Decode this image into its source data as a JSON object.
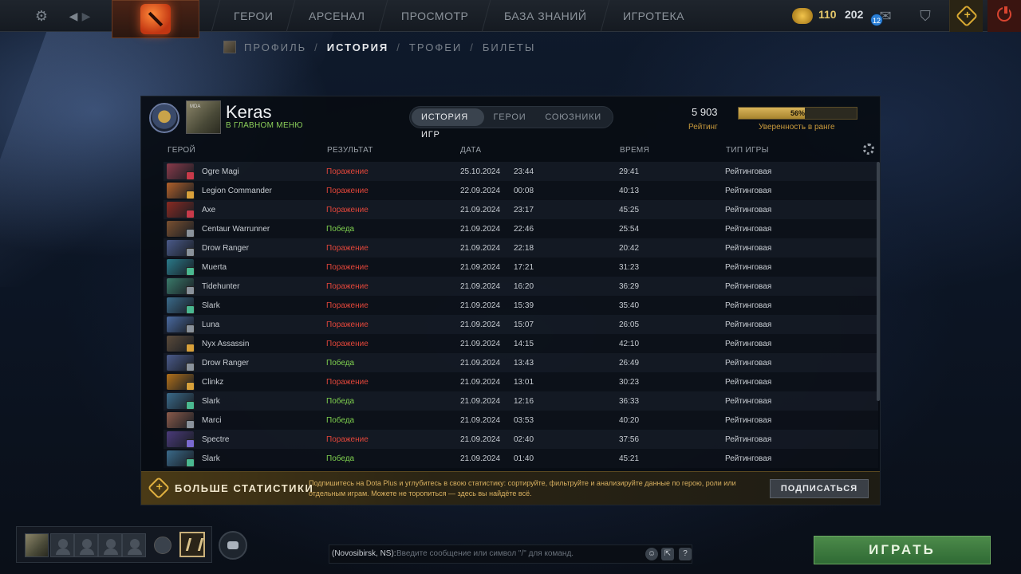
{
  "topbar": {
    "nav": [
      "ГЕРОИ",
      "АРСЕНАЛ",
      "ПРОСМОТР",
      "БАЗА ЗНАНИЙ",
      "ИГРОТЕКА"
    ],
    "gold": "110",
    "shards": "202",
    "notifications": "12"
  },
  "subnav": {
    "items": [
      "ПРОФИЛЬ",
      "ИСТОРИЯ",
      "ТРОФЕИ",
      "БИЛЕТЫ"
    ],
    "separator": "/"
  },
  "profile": {
    "name": "Keras",
    "status": "В ГЛАВНОМ МЕНЮ",
    "avatar_text": "MDA",
    "tabs": [
      "ИСТОРИЯ ИГР",
      "ГЕРОИ",
      "СОЮЗНИКИ"
    ],
    "rating": "5 903",
    "rating_label": "Рейтинг",
    "confidence": "56%",
    "confidence_value": 0.56,
    "confidence_label": "Уверенность в ранге"
  },
  "columns": {
    "hero": "ГЕРОЙ",
    "result": "РЕЗУЛЬТАТ",
    "date": "ДАТА",
    "time": "ВРЕМЯ",
    "mode": "ТИП ИГРЫ"
  },
  "matches": [
    {
      "hero": "Ogre Magi",
      "result": "Поражение",
      "win": false,
      "date": "25.10.2024",
      "clock": "23:44",
      "duration": "29:41",
      "mode": "Рейтинговая",
      "pic": "#8a3a4a",
      "role": "#c83a4a"
    },
    {
      "hero": "Legion Commander",
      "result": "Поражение",
      "win": false,
      "date": "22.09.2024",
      "clock": "00:08",
      "duration": "40:13",
      "mode": "Рейтинговая",
      "pic": "#b0602a",
      "role": "#d8a03a"
    },
    {
      "hero": "Axe",
      "result": "Поражение",
      "win": false,
      "date": "21.09.2024",
      "clock": "23:17",
      "duration": "45:25",
      "mode": "Рейтинговая",
      "pic": "#8a2a22",
      "role": "#c83a4a"
    },
    {
      "hero": "Centaur Warrunner",
      "result": "Победа",
      "win": true,
      "date": "21.09.2024",
      "clock": "22:46",
      "duration": "25:54",
      "mode": "Рейтинговая",
      "pic": "#7a5030",
      "role": "#8a929b"
    },
    {
      "hero": "Drow Ranger",
      "result": "Поражение",
      "win": false,
      "date": "21.09.2024",
      "clock": "22:18",
      "duration": "20:42",
      "mode": "Рейтинговая",
      "pic": "#4a5a8a",
      "role": "#8a929b"
    },
    {
      "hero": "Muerta",
      "result": "Поражение",
      "win": false,
      "date": "21.09.2024",
      "clock": "17:21",
      "duration": "31:23",
      "mode": "Рейтинговая",
      "pic": "#2a7a8a",
      "role": "#4ab890"
    },
    {
      "hero": "Tidehunter",
      "result": "Поражение",
      "win": false,
      "date": "21.09.2024",
      "clock": "16:20",
      "duration": "36:29",
      "mode": "Рейтинговая",
      "pic": "#3a7a6a",
      "role": "#8a929b"
    },
    {
      "hero": "Slark",
      "result": "Поражение",
      "win": false,
      "date": "21.09.2024",
      "clock": "15:39",
      "duration": "35:40",
      "mode": "Рейтинговая",
      "pic": "#3a6a8a",
      "role": "#4ab890"
    },
    {
      "hero": "Luna",
      "result": "Поражение",
      "win": false,
      "date": "21.09.2024",
      "clock": "15:07",
      "duration": "26:05",
      "mode": "Рейтинговая",
      "pic": "#4a6aa0",
      "role": "#8a929b"
    },
    {
      "hero": "Nyx Assassin",
      "result": "Поражение",
      "win": false,
      "date": "21.09.2024",
      "clock": "14:15",
      "duration": "42:10",
      "mode": "Рейтинговая",
      "pic": "#5a4a3a",
      "role": "#d8a03a"
    },
    {
      "hero": "Drow Ranger",
      "result": "Победа",
      "win": true,
      "date": "21.09.2024",
      "clock": "13:43",
      "duration": "26:49",
      "mode": "Рейтинговая",
      "pic": "#4a5a8a",
      "role": "#8a929b"
    },
    {
      "hero": "Clinkz",
      "result": "Поражение",
      "win": false,
      "date": "21.09.2024",
      "clock": "13:01",
      "duration": "30:23",
      "mode": "Рейтинговая",
      "pic": "#b0701a",
      "role": "#d8a03a"
    },
    {
      "hero": "Slark",
      "result": "Победа",
      "win": true,
      "date": "21.09.2024",
      "clock": "12:16",
      "duration": "36:33",
      "mode": "Рейтинговая",
      "pic": "#3a6a8a",
      "role": "#4ab890"
    },
    {
      "hero": "Marci",
      "result": "Победа",
      "win": true,
      "date": "21.09.2024",
      "clock": "03:53",
      "duration": "40:20",
      "mode": "Рейтинговая",
      "pic": "#8a5a4a",
      "role": "#8a929b"
    },
    {
      "hero": "Spectre",
      "result": "Поражение",
      "win": false,
      "date": "21.09.2024",
      "clock": "02:40",
      "duration": "37:56",
      "mode": "Рейтинговая",
      "pic": "#4a3a7a",
      "role": "#7a6ad0"
    },
    {
      "hero": "Slark",
      "result": "Победа",
      "win": true,
      "date": "21.09.2024",
      "clock": "01:40",
      "duration": "45:21",
      "mode": "Рейтинговая",
      "pic": "#3a6a8a",
      "role": "#4ab890"
    }
  ],
  "promo": {
    "title": "БОЛЬШЕ СТАТИСТИКИ",
    "text": "Подпишитесь на Dota Plus и углубитесь в свою статистику: сортируйте, фильтруйте и анализируйте данные по герою, роли или отдельным играм. Можете не торопиться — здесь вы найдёте всё.",
    "button": "ПОДПИСАТЬСЯ"
  },
  "chat": {
    "channel": "(Novosibirsk, NS):",
    "placeholder": "Введите сообщение или символ \"/\" для команд.",
    "help": "?"
  },
  "play_button": "ИГРАТЬ"
}
